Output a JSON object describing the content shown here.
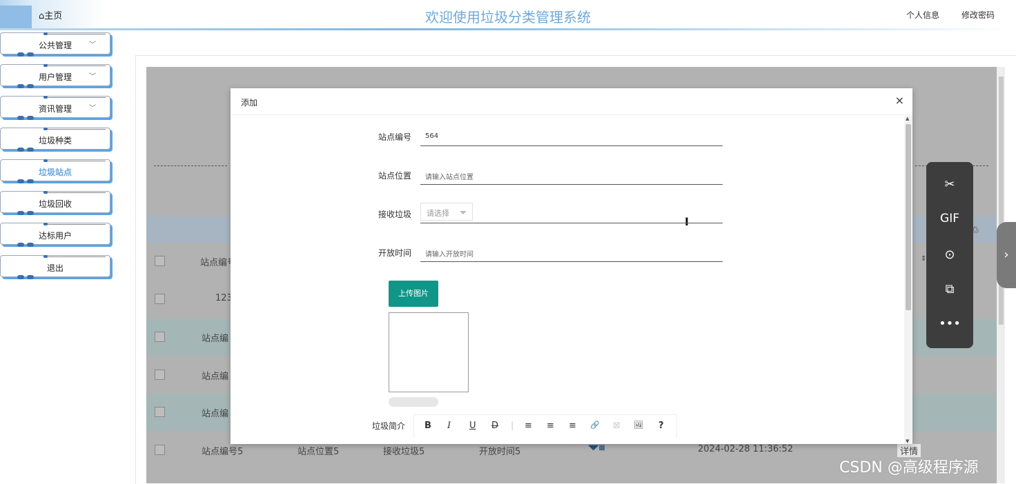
{
  "header": {
    "home": "⌂主页",
    "title": "欢迎使用垃圾分类管理系统",
    "profile": "个人信息",
    "change_password": "修改密码"
  },
  "sidebar": {
    "items": [
      {
        "label": "公共管理",
        "expandable": true
      },
      {
        "label": "用户管理",
        "expandable": true
      },
      {
        "label": "资讯管理",
        "expandable": true
      },
      {
        "label": "垃圾种类",
        "expandable": false
      },
      {
        "label": "垃圾站点",
        "expandable": false,
        "active": true
      },
      {
        "label": "垃圾回收",
        "expandable": false
      },
      {
        "label": "达标用户",
        "expandable": false
      },
      {
        "label": "退出",
        "expandable": false
      }
    ]
  },
  "background_table": {
    "header_col1": "站点编号",
    "rows": [
      {
        "col1": "123"
      },
      {
        "col1": "站点编"
      },
      {
        "col1": "站点编"
      },
      {
        "col1": "站点编"
      }
    ],
    "last_row": {
      "station_no": "站点编号5",
      "location": "站点位置5",
      "waste": "接收垃圾5",
      "open_time": "开放时间5",
      "datetime": "2024-02-28 11:36:52",
      "action": "详情"
    }
  },
  "modal": {
    "title": "添加",
    "close": "×",
    "fields": {
      "station_no_label": "站点编号",
      "station_no_value": "564",
      "location_label": "站点位置",
      "location_placeholder": "请输入站点位置",
      "waste_label": "接收垃圾",
      "waste_select": "请选择",
      "open_time_label": "开放时间",
      "open_time_placeholder": "请输入开放时间"
    },
    "upload_button": "上传图片",
    "intro_label": "垃圾简介",
    "editor_buttons": [
      "B",
      "I",
      "U",
      "D",
      "≡",
      "≡",
      "≡",
      "🔗",
      "⊠",
      "🖼",
      "?"
    ]
  },
  "floatbar": {
    "items": [
      "scissors-icon",
      "GIF",
      "record-icon",
      "screenshot-icon",
      "•••"
    ]
  },
  "watermark": "CSDN @高级程序源"
}
